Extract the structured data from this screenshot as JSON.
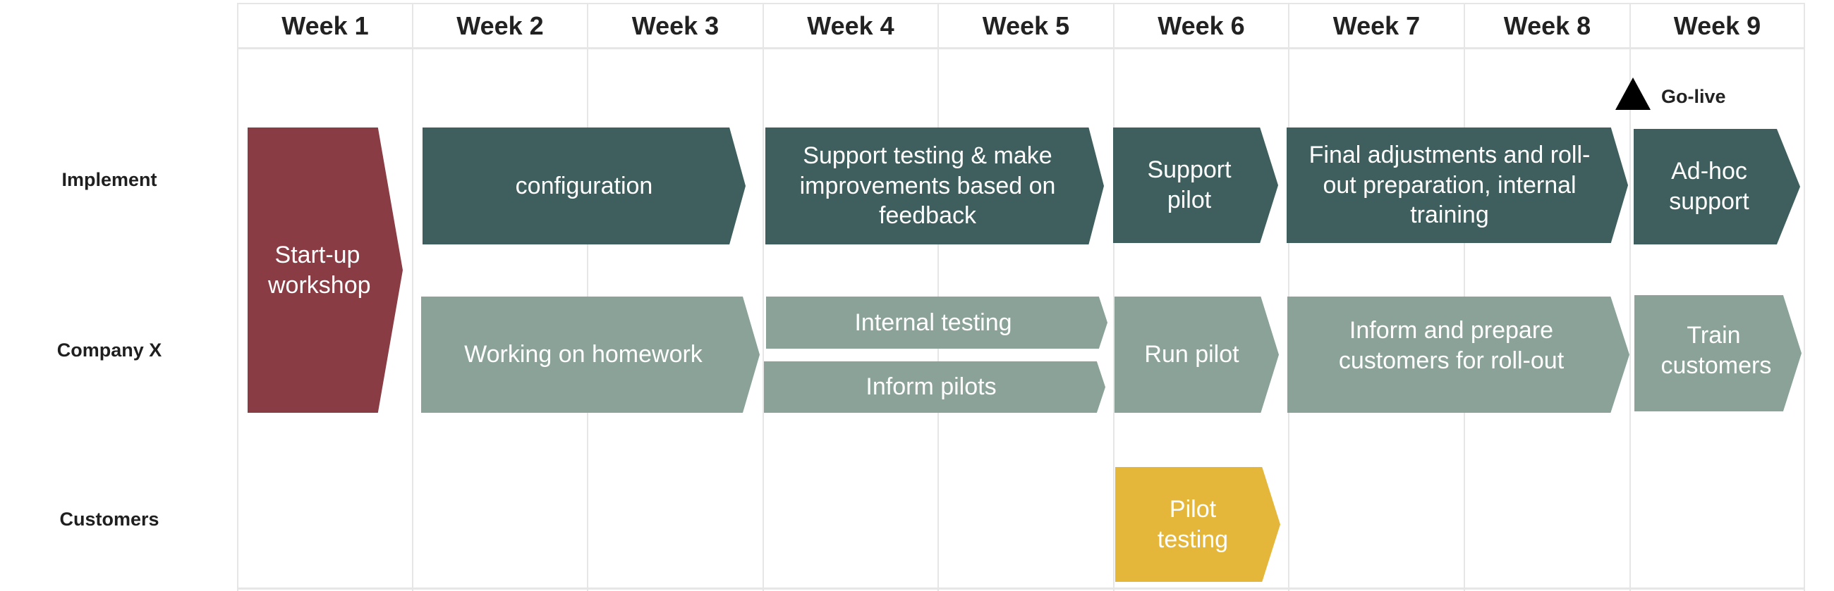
{
  "timeline": {
    "weeks": [
      "Week 1",
      "Week 2",
      "Week 3",
      "Week 4",
      "Week 5",
      "Week 6",
      "Week 7",
      "Week 8",
      "Week 9"
    ],
    "rows": [
      "Implement",
      "Company X",
      "Customers"
    ],
    "milestone": {
      "label": "Go-live",
      "icon": "triangle-up-icon",
      "at_week": 9
    },
    "colors": {
      "startup": "#8a3c45",
      "implement": "#3f5f5e",
      "company": "#8aa298",
      "customers": "#e4b73a"
    },
    "activities": [
      {
        "label": "Start-up workshop",
        "row": "Implement + Company X",
        "weeks": [
          1,
          1
        ]
      },
      {
        "label": "configuration",
        "row": "Implement",
        "weeks": [
          2,
          3
        ]
      },
      {
        "label": "Support testing & make improvements  based on feedback",
        "row": "Implement",
        "weeks": [
          4,
          5
        ]
      },
      {
        "label": "Support pilot",
        "row": "Implement",
        "weeks": [
          6,
          6
        ]
      },
      {
        "label": "Final adjustments  and roll-out preparation, internal training",
        "row": "Implement",
        "weeks": [
          7,
          8
        ]
      },
      {
        "label": "Ad-hoc support",
        "row": "Implement",
        "weeks": [
          9,
          9
        ]
      },
      {
        "label": "Working on homework",
        "row": "Company X",
        "weeks": [
          2,
          3
        ]
      },
      {
        "label": "Internal testing",
        "row": "Company X",
        "weeks": [
          4,
          5
        ]
      },
      {
        "label": "Inform pilots",
        "row": "Company X",
        "weeks": [
          4,
          5
        ]
      },
      {
        "label": "Run pilot",
        "row": "Company X",
        "weeks": [
          6,
          6
        ]
      },
      {
        "label": "Inform and prepare customers for roll-out",
        "row": "Company X",
        "weeks": [
          7,
          8
        ]
      },
      {
        "label": "Train customers",
        "row": "Company X",
        "weeks": [
          9,
          9
        ]
      },
      {
        "label": "Pilot testing",
        "row": "Customers",
        "weeks": [
          6,
          6
        ]
      }
    ]
  }
}
